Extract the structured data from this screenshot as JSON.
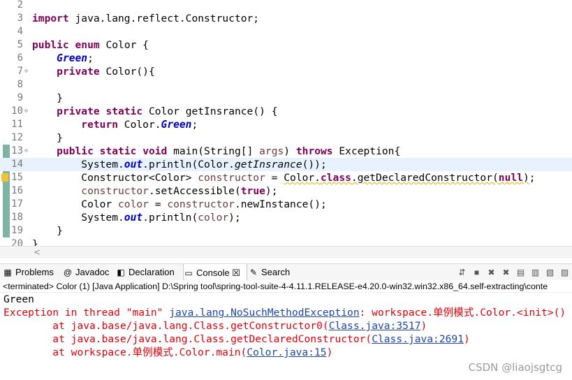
{
  "editor": {
    "lines": [
      {
        "num": "2",
        "fold": "",
        "tokens": []
      },
      {
        "num": "3",
        "fold": "",
        "tokens": [
          {
            "t": "import",
            "c": "kw"
          },
          {
            "t": " java.lang.reflect.Constructor;",
            "c": ""
          }
        ]
      },
      {
        "num": "4",
        "fold": "",
        "tokens": []
      },
      {
        "num": "5",
        "fold": "",
        "tokens": [
          {
            "t": "public",
            "c": "kw"
          },
          {
            "t": " ",
            "c": ""
          },
          {
            "t": "enum",
            "c": "kw"
          },
          {
            "t": " Color {",
            "c": ""
          }
        ]
      },
      {
        "num": "6",
        "fold": "",
        "tokens": [
          {
            "t": "    ",
            "c": ""
          },
          {
            "t": "Green",
            "c": "const"
          },
          {
            "t": ";",
            "c": ""
          }
        ]
      },
      {
        "num": "7",
        "fold": "⊖",
        "tokens": [
          {
            "t": "    ",
            "c": ""
          },
          {
            "t": "private",
            "c": "kw"
          },
          {
            "t": " Color(){",
            "c": ""
          }
        ]
      },
      {
        "num": "8",
        "fold": "",
        "tokens": []
      },
      {
        "num": "9",
        "fold": "",
        "tokens": [
          {
            "t": "    }",
            "c": ""
          }
        ]
      },
      {
        "num": "10",
        "fold": "⊖",
        "tokens": [
          {
            "t": "    ",
            "c": ""
          },
          {
            "t": "private",
            "c": "kw"
          },
          {
            "t": " ",
            "c": ""
          },
          {
            "t": "static",
            "c": "kw"
          },
          {
            "t": " Color getInsrance() {",
            "c": ""
          }
        ]
      },
      {
        "num": "11",
        "fold": "",
        "tokens": [
          {
            "t": "        ",
            "c": ""
          },
          {
            "t": "return",
            "c": "kw"
          },
          {
            "t": " Color.",
            "c": ""
          },
          {
            "t": "Green",
            "c": "const"
          },
          {
            "t": ";",
            "c": ""
          }
        ]
      },
      {
        "num": "12",
        "fold": "",
        "tokens": [
          {
            "t": "    }",
            "c": ""
          }
        ]
      },
      {
        "num": "13",
        "fold": "⊖",
        "tokens": [
          {
            "t": "    ",
            "c": ""
          },
          {
            "t": "public",
            "c": "kw"
          },
          {
            "t": " ",
            "c": ""
          },
          {
            "t": "static",
            "c": "kw"
          },
          {
            "t": " ",
            "c": ""
          },
          {
            "t": "void",
            "c": "kw"
          },
          {
            "t": " main(String[] ",
            "c": ""
          },
          {
            "t": "args",
            "c": "var"
          },
          {
            "t": ") ",
            "c": ""
          },
          {
            "t": "throws",
            "c": "kw"
          },
          {
            "t": " Exception{",
            "c": ""
          }
        ]
      },
      {
        "num": "14",
        "fold": "",
        "current": true,
        "tokens": [
          {
            "t": "        System.",
            "c": ""
          },
          {
            "t": "out",
            "c": "field"
          },
          {
            "t": ".println(Color.",
            "c": ""
          },
          {
            "t": "getInsrance",
            "c": "smeth"
          },
          {
            "t": "());",
            "c": ""
          }
        ]
      },
      {
        "num": "15",
        "fold": "",
        "warn": true,
        "tokens": [
          {
            "t": "        Constructor<Color> ",
            "c": ""
          },
          {
            "t": "constructor",
            "c": "var"
          },
          {
            "t": " = ",
            "c": ""
          },
          {
            "t": "Color.",
            "c": "warn"
          },
          {
            "t": "class",
            "c": "kw warn"
          },
          {
            "t": ".getDeclaredConstructor(",
            "c": "warn"
          },
          {
            "t": "null",
            "c": "kw warn"
          },
          {
            "t": ")",
            "c": "warn"
          },
          {
            "t": ";",
            "c": ""
          }
        ]
      },
      {
        "num": "16",
        "fold": "",
        "tokens": [
          {
            "t": "        ",
            "c": ""
          },
          {
            "t": "constructor",
            "c": "var"
          },
          {
            "t": ".setAccessible(",
            "c": ""
          },
          {
            "t": "true",
            "c": "kw"
          },
          {
            "t": ");",
            "c": ""
          }
        ]
      },
      {
        "num": "17",
        "fold": "",
        "tokens": [
          {
            "t": "        Color ",
            "c": ""
          },
          {
            "t": "color",
            "c": "var"
          },
          {
            "t": " = ",
            "c": ""
          },
          {
            "t": "constructor",
            "c": "var"
          },
          {
            "t": ".newInstance();",
            "c": ""
          }
        ]
      },
      {
        "num": "18",
        "fold": "",
        "tokens": [
          {
            "t": "        System.",
            "c": ""
          },
          {
            "t": "out",
            "c": "field"
          },
          {
            "t": ".println(",
            "c": ""
          },
          {
            "t": "color",
            "c": "var"
          },
          {
            "t": ");",
            "c": ""
          }
        ]
      },
      {
        "num": "19",
        "fold": "",
        "tokens": [
          {
            "t": "    }",
            "c": ""
          }
        ]
      },
      {
        "num": "20",
        "fold": "",
        "tokens": [
          {
            "t": "}",
            "c": ""
          }
        ]
      }
    ]
  },
  "scroll_arrow": "<",
  "tabs": [
    {
      "label": "Problems",
      "icon": "problems-icon",
      "glyph": "▦",
      "active": false
    },
    {
      "label": "Javadoc",
      "icon": "at-icon",
      "glyph": "@",
      "active": false
    },
    {
      "label": "Declaration",
      "icon": "declaration-icon",
      "glyph": "◧",
      "active": false
    },
    {
      "label": "Console ☒",
      "icon": "console-icon",
      "glyph": "▭",
      "active": true
    },
    {
      "label": "Search",
      "icon": "search-icon",
      "glyph": "✎",
      "active": false
    }
  ],
  "toolbar": [
    {
      "icon": "pin-icon",
      "glyph": "⇵"
    },
    {
      "icon": "stop-icon",
      "glyph": "■"
    },
    {
      "icon": "remove-launch-icon",
      "glyph": "✖"
    },
    {
      "icon": "remove-all-icon",
      "glyph": "✖"
    },
    {
      "icon": "clear-console-icon",
      "glyph": "▤"
    },
    {
      "icon": "scroll-lock-icon",
      "glyph": "▥"
    },
    {
      "icon": "word-wrap-icon",
      "glyph": "▧"
    },
    {
      "icon": "display-console-icon",
      "glyph": "▨"
    }
  ],
  "status": "<terminated> Color (1) [Java Application] D:\\Spring tool\\spring-tool-suite-4-4.11.1.RELEASE-e4.20.0-win32.win32.x86_64.self-extracting\\conte",
  "console": {
    "line1": "Green",
    "err1_prefix": "Exception in thread \"main\" ",
    "err1_link": "java.lang.NoSuchMethodException",
    "err1_suffix": ": workspace.单例模式.Color.<init>()",
    "st1_prefix": "\tat java.base/java.lang.Class.getConstructor0(",
    "st1_link": "Class.java:3517",
    "st1_suffix": ")",
    "st2_prefix": "\tat java.base/java.lang.Class.getDeclaredConstructor(",
    "st2_link": "Class.java:2691",
    "st2_suffix": ")",
    "st3_prefix": "\tat workspace.单例模式.Color.main(",
    "st3_link": "Color.java:15",
    "st3_suffix": ")"
  },
  "watermark": "CSDN @liaojsgtcg",
  "colors": {
    "keyword": "#7f0055",
    "constant": "#0000c0",
    "error": "#e2000a",
    "link": "#1e46a8"
  }
}
